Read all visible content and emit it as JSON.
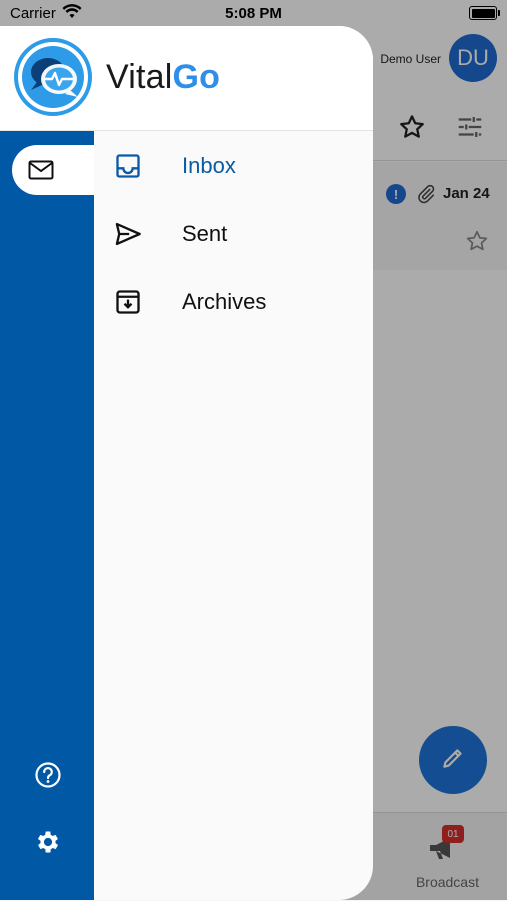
{
  "status_bar": {
    "carrier": "Carrier",
    "time": "5:08 PM"
  },
  "background": {
    "user_name": "Demo User",
    "avatar_initials": "DU",
    "message_row": {
      "date": "Jan 24",
      "alert_glyph": "!"
    },
    "bottom_nav": {
      "broadcast_label": "Broadcast",
      "broadcast_badge": "01"
    }
  },
  "drawer": {
    "brand": {
      "part1": "Vital",
      "part2": "Go"
    },
    "menu": [
      {
        "label": "Inbox",
        "icon": "inbox-icon",
        "active": true
      },
      {
        "label": "Sent",
        "icon": "send-icon",
        "active": false
      },
      {
        "label": "Archives",
        "icon": "archive-icon",
        "active": false
      }
    ],
    "rail": {
      "top_icon": "mail-icon",
      "bottom_icons": [
        "help-icon",
        "settings-icon"
      ]
    }
  },
  "colors": {
    "rail": "#0159a6",
    "accent": "#2e8ee8",
    "active_text": "#0a5aa6",
    "fab": "#1e73d8",
    "badge": "#d32f2f"
  }
}
